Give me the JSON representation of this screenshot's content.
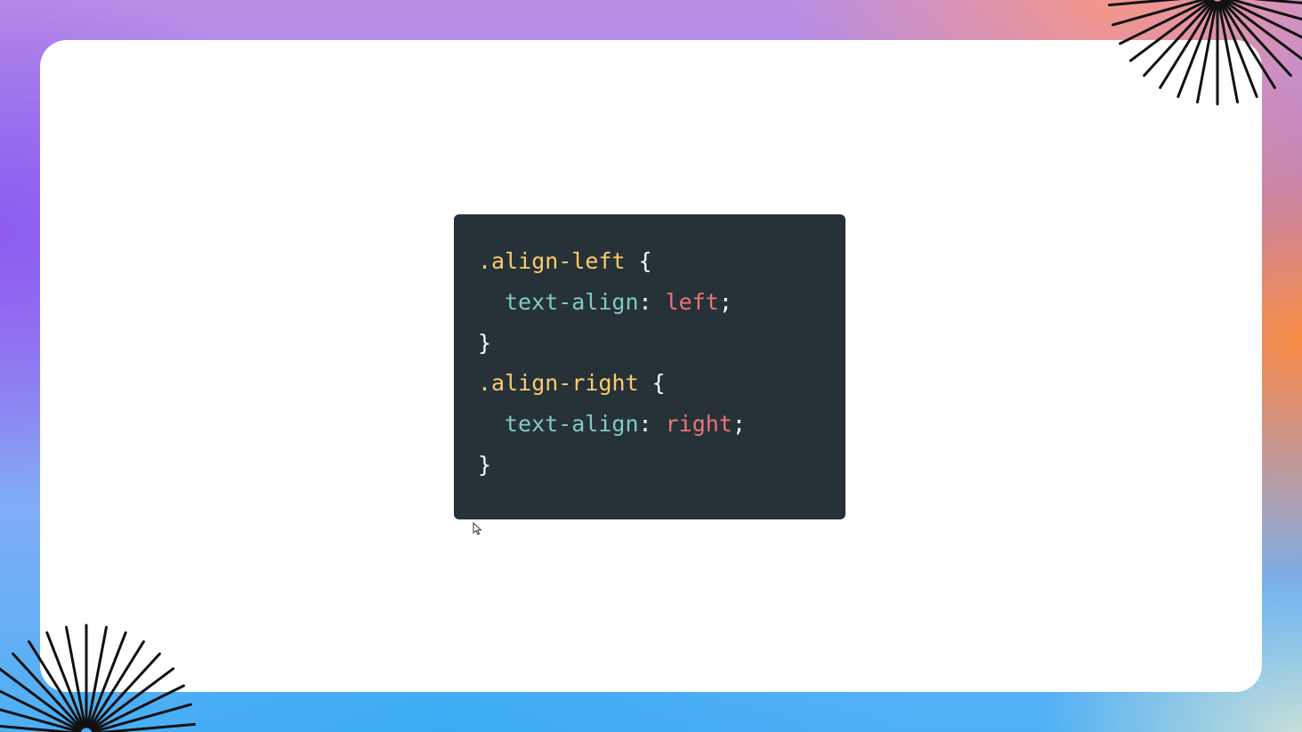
{
  "code": {
    "lines": [
      {
        "selector": ".align-left",
        "open_brace": " {"
      },
      {
        "property": "text-align",
        "colon": ": ",
        "value": "left",
        "semicolon": ";"
      },
      {
        "close_brace": "}"
      },
      {
        "selector": ".align-right",
        "open_brace": " {"
      },
      {
        "property": "text-align",
        "colon": ": ",
        "value": "right",
        "semicolon": ";"
      },
      {
        "close_brace": "}"
      }
    ]
  },
  "colors": {
    "code_background": "#263238",
    "selector": "#ffcb6b",
    "property": "#80cbc4",
    "value": "#f07178",
    "punctuation": "#eeffff"
  },
  "icons": {
    "top_right_decoration": "sunburst-lines",
    "bottom_left_decoration": "sunburst-lines",
    "cursor": "mouse-pointer-arrow"
  }
}
